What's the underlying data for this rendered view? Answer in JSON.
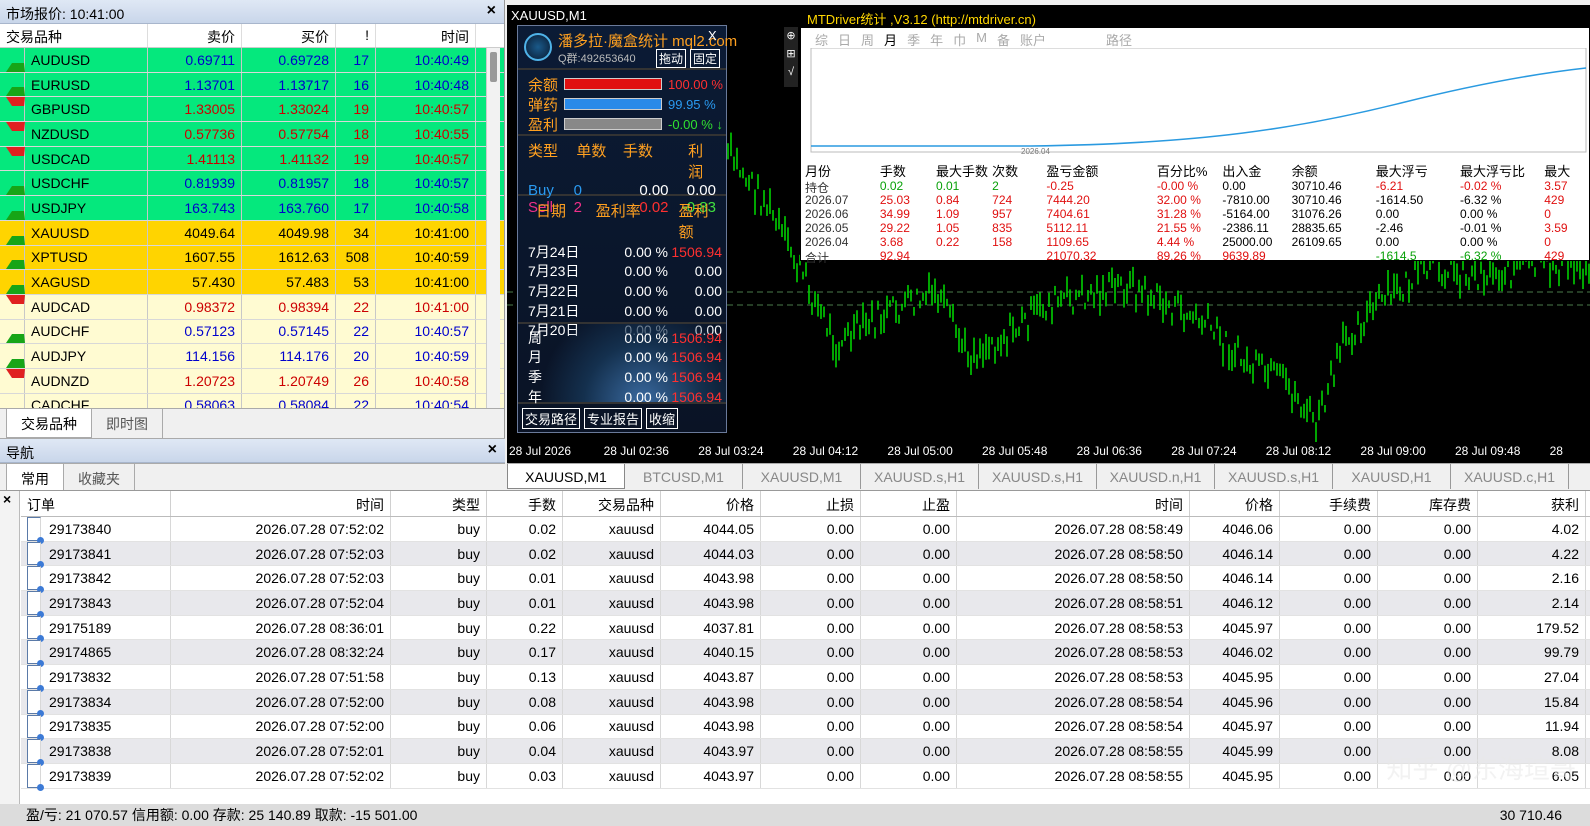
{
  "market_watch": {
    "title": "市场报价: 10:41:00",
    "columns": [
      "交易品种",
      "卖价",
      "买价",
      "!",
      "时间"
    ],
    "rows": [
      {
        "sym": "AUDUSD",
        "bid": "0.69711",
        "ask": "0.69728",
        "sp": "17",
        "time": "10:40:49",
        "dir": "up",
        "bg": "#05e87d",
        "col": "#0000cc"
      },
      {
        "sym": "EURUSD",
        "bid": "1.13701",
        "ask": "1.13717",
        "sp": "16",
        "time": "10:40:48",
        "dir": "up",
        "bg": "#05e87d",
        "col": "#0000cc"
      },
      {
        "sym": "GBPUSD",
        "bid": "1.33005",
        "ask": "1.33024",
        "sp": "19",
        "time": "10:40:57",
        "dir": "dn",
        "bg": "#05e87d",
        "col": "#cc0000"
      },
      {
        "sym": "NZDUSD",
        "bid": "0.57736",
        "ask": "0.57754",
        "sp": "18",
        "time": "10:40:55",
        "dir": "dn",
        "bg": "#05e87d",
        "col": "#cc0000"
      },
      {
        "sym": "USDCAD",
        "bid": "1.41113",
        "ask": "1.41132",
        "sp": "19",
        "time": "10:40:57",
        "dir": "dn",
        "bg": "#05e87d",
        "col": "#cc0000"
      },
      {
        "sym": "USDCHF",
        "bid": "0.81939",
        "ask": "0.81957",
        "sp": "18",
        "time": "10:40:57",
        "dir": "up",
        "bg": "#05e87d",
        "col": "#0000cc"
      },
      {
        "sym": "USDJPY",
        "bid": "163.743",
        "ask": "163.760",
        "sp": "17",
        "time": "10:40:58",
        "dir": "up",
        "bg": "#05e87d",
        "col": "#0000cc"
      },
      {
        "sym": "XAUUSD",
        "bid": "4049.64",
        "ask": "4049.98",
        "sp": "34",
        "time": "10:41:00",
        "dir": "up",
        "bg": "#ffd400",
        "col": "#000000"
      },
      {
        "sym": "XPTUSD",
        "bid": "1607.55",
        "ask": "1612.63",
        "sp": "508",
        "time": "10:40:59",
        "dir": "up",
        "bg": "#ffd400",
        "col": "#000000"
      },
      {
        "sym": "XAGUSD",
        "bid": "57.430",
        "ask": "57.483",
        "sp": "53",
        "time": "10:41:00",
        "dir": "up",
        "bg": "#ffd400",
        "col": "#000000"
      },
      {
        "sym": "AUDCAD",
        "bid": "0.98372",
        "ask": "0.98394",
        "sp": "22",
        "time": "10:41:00",
        "dir": "dn",
        "bg": "#fffbd2",
        "col": "#cc0000"
      },
      {
        "sym": "AUDCHF",
        "bid": "0.57123",
        "ask": "0.57145",
        "sp": "22",
        "time": "10:40:57",
        "dir": "up",
        "bg": "#fffbd2",
        "col": "#0000cc"
      },
      {
        "sym": "AUDJPY",
        "bid": "114.156",
        "ask": "114.176",
        "sp": "20",
        "time": "10:40:59",
        "dir": "up",
        "bg": "#fffbd2",
        "col": "#0000cc"
      },
      {
        "sym": "AUDNZD",
        "bid": "1.20723",
        "ask": "1.20749",
        "sp": "26",
        "time": "10:40:58",
        "dir": "dn",
        "bg": "#fffbd2",
        "col": "#cc0000"
      },
      {
        "sym": "CADCHF",
        "bid": "0.58063",
        "ask": "0.58084",
        "sp": "22",
        "time": "10:40:54",
        "dir": "up",
        "bg": "#fffbd2",
        "col": "#0000cc"
      }
    ],
    "tabs": [
      "交易品种",
      "即时图"
    ]
  },
  "navigator": {
    "title": "导航",
    "tabs": [
      "常用",
      "收藏夹"
    ]
  },
  "chart": {
    "symbol_label": "XAUUSD,M1",
    "time_labels": [
      "28 Jul 2026",
      "28 Jul 02:36",
      "28 Jul 03:24",
      "28 Jul 04:12",
      "28 Jul 05:00",
      "28 Jul 05:48",
      "28 Jul 06:36",
      "28 Jul 07:24",
      "28 Jul 08:12",
      "28 Jul 09:00",
      "28 Jul 09:48",
      "28"
    ],
    "colors": {
      "bg": "#000000",
      "candle": "#00d000",
      "grid": "#4a7a4a"
    }
  },
  "stats_panel": {
    "title": "MTDriver统计 ,V3.12 (http://mtdriver.cn)",
    "periods": [
      "综",
      "日",
      "周",
      "月",
      "季",
      "年",
      "巾",
      "M",
      "备",
      "账户",
      "路径"
    ],
    "chart_date": "2026.04",
    "headers": [
      "月份",
      "手数",
      "最大手数",
      "次数",
      "盈亏金额",
      "百分比%",
      "出入金",
      "余额",
      "最大浮亏",
      "最大浮亏比",
      "最大"
    ],
    "rows": [
      [
        "持仓",
        "0.02",
        "0.01",
        "2",
        "-0.25",
        "-0.00 %",
        "0.00",
        "30710.46",
        "-6.21",
        "-0.02 %",
        "3.57"
      ],
      [
        "2026.07",
        "25.03",
        "0.84",
        "724",
        "7444.20",
        "32.00 %",
        "-7810.00",
        "30710.46",
        "-1614.50",
        "-6.32 %",
        "429"
      ],
      [
        "2026.06",
        "34.99",
        "1.09",
        "957",
        "7404.61",
        "31.28 %",
        "-5164.00",
        "31076.26",
        "0.00",
        "0.00 %",
        "0"
      ],
      [
        "2026.05",
        "29.22",
        "1.05",
        "835",
        "5112.11",
        "21.55 %",
        "-2386.11",
        "28835.65",
        "-2.46",
        "-0.01 %",
        "3.59"
      ],
      [
        "2026.04",
        "3.68",
        "0.22",
        "158",
        "1109.65",
        "4.44 %",
        "25000.00",
        "26109.65",
        "0.00",
        "0.00 %",
        "0"
      ]
    ],
    "total": [
      "合计",
      "92.94",
      "",
      "",
      "21070.32",
      "89.26 %",
      "9639.89",
      "",
      "-1614.5",
      "-6.32 %",
      "429"
    ]
  },
  "overlay": {
    "title": "潘多拉·魔盒统计 mql2.com",
    "qq": "Q群:492653640",
    "btn1": "拖动",
    "btn2": "固定",
    "bars": [
      {
        "label": "余额",
        "value": "100.00 %",
        "color": "#e01010"
      },
      {
        "label": "弹药",
        "value": "99.95 %",
        "color": "#2a8ae8"
      },
      {
        "label": "盈利",
        "value": "-0.00 % ↓",
        "color": "#888888"
      }
    ],
    "type_headers": [
      "类型",
      "单数",
      "手数",
      "利润"
    ],
    "buy": [
      "Buy",
      "0",
      "0.00",
      "0.00"
    ],
    "sell": [
      "Sell",
      "2",
      "0.02",
      "-0.83"
    ],
    "day_headers": [
      "日期",
      "盈利率",
      "盈利额"
    ],
    "days": [
      [
        "7月24日",
        "0.00 %",
        "1506.94"
      ],
      [
        "7月23日",
        "0.00 %",
        "0.00"
      ],
      [
        "7月22日",
        "0.00 %",
        "0.00"
      ],
      [
        "7月21日",
        "0.00 %",
        "0.00"
      ],
      [
        "7月20日",
        "0.00 %",
        "0.00"
      ]
    ],
    "periods": [
      [
        "周",
        "0.00 %",
        "1506.94"
      ],
      [
        "月",
        "0.00 %",
        "1506.94"
      ],
      [
        "季",
        "0.00 %",
        "1506.94"
      ],
      [
        "年",
        "0.00 %",
        "1506.94"
      ]
    ],
    "btns": [
      "交易路径",
      "专业报告",
      "收缩"
    ]
  },
  "chart_tabs": [
    "XAUUSD,M1",
    "BTCUSD,M1",
    "XAUUSD,M1",
    "XAUUSD.s,H1",
    "XAUUSD.s,H1",
    "XAUUSD.n,H1",
    "XAUUSD.s,H1",
    "XAUUSD,H1",
    "XAUUSD.c,H1"
  ],
  "terminal": {
    "columns": [
      "订单",
      "时间",
      "类型",
      "手数",
      "交易品种",
      "价格",
      "止损",
      "止盈",
      "时间",
      "价格",
      "手续费",
      "库存费",
      "获利"
    ],
    "rows": [
      [
        "29173840",
        "2026.07.28 07:52:02",
        "buy",
        "0.02",
        "xauusd",
        "4044.05",
        "0.00",
        "0.00",
        "2026.07.28 08:58:49",
        "4046.06",
        "0.00",
        "0.00",
        "4.02"
      ],
      [
        "29173841",
        "2026.07.28 07:52:03",
        "buy",
        "0.02",
        "xauusd",
        "4044.03",
        "0.00",
        "0.00",
        "2026.07.28 08:58:50",
        "4046.14",
        "0.00",
        "0.00",
        "4.22"
      ],
      [
        "29173842",
        "2026.07.28 07:52:03",
        "buy",
        "0.01",
        "xauusd",
        "4043.98",
        "0.00",
        "0.00",
        "2026.07.28 08:58:50",
        "4046.14",
        "0.00",
        "0.00",
        "2.16"
      ],
      [
        "29173843",
        "2026.07.28 07:52:04",
        "buy",
        "0.01",
        "xauusd",
        "4043.98",
        "0.00",
        "0.00",
        "2026.07.28 08:58:51",
        "4046.12",
        "0.00",
        "0.00",
        "2.14"
      ],
      [
        "29175189",
        "2026.07.28 08:36:01",
        "buy",
        "0.22",
        "xauusd",
        "4037.81",
        "0.00",
        "0.00",
        "2026.07.28 08:58:53",
        "4045.97",
        "0.00",
        "0.00",
        "179.52"
      ],
      [
        "29174865",
        "2026.07.28 08:32:24",
        "buy",
        "0.17",
        "xauusd",
        "4040.15",
        "0.00",
        "0.00",
        "2026.07.28 08:58:53",
        "4046.02",
        "0.00",
        "0.00",
        "99.79"
      ],
      [
        "29173832",
        "2026.07.28 07:51:58",
        "buy",
        "0.13",
        "xauusd",
        "4043.87",
        "0.00",
        "0.00",
        "2026.07.28 08:58:53",
        "4045.95",
        "0.00",
        "0.00",
        "27.04"
      ],
      [
        "29173834",
        "2026.07.28 07:52:00",
        "buy",
        "0.08",
        "xauusd",
        "4043.98",
        "0.00",
        "0.00",
        "2026.07.28 08:58:54",
        "4045.96",
        "0.00",
        "0.00",
        "15.84"
      ],
      [
        "29173835",
        "2026.07.28 07:52:00",
        "buy",
        "0.06",
        "xauusd",
        "4043.98",
        "0.00",
        "0.00",
        "2026.07.28 08:58:54",
        "4045.97",
        "0.00",
        "0.00",
        "11.94"
      ],
      [
        "29173838",
        "2026.07.28 07:52:01",
        "buy",
        "0.04",
        "xauusd",
        "4043.97",
        "0.00",
        "0.00",
        "2026.07.28 08:58:55",
        "4045.99",
        "0.00",
        "0.00",
        "8.08"
      ],
      [
        "29173839",
        "2026.07.28 07:52:02",
        "buy",
        "0.03",
        "xauusd",
        "4043.97",
        "0.00",
        "0.00",
        "2026.07.28 08:58:55",
        "4045.95",
        "0.00",
        "0.00",
        "6.05"
      ]
    ],
    "footer_left": "盈/亏: 21 070.57  信用额: 0.00  存款: 25 140.89  取款: -15 501.00",
    "footer_right": "30 710.46",
    "watermark": "知乎 @东海瑄哥"
  }
}
